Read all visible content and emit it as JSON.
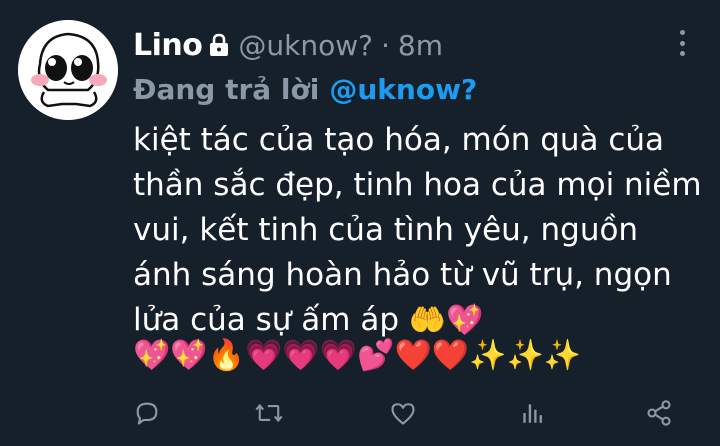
{
  "tweet": {
    "author_name": "Lino",
    "author_handle": "@uknow?",
    "separator": "·",
    "timestamp": "8m",
    "reply_label": "Đang trả lời",
    "reply_to": "@uknow?",
    "text": "kiệt tác của tạo hóa, món quà của thần sắc đẹp, tinh hoa của mọi niềm vui, kết tinh của tình yêu, nguồn ánh sáng hoàn hảo từ vũ trụ, ngọn lửa của sự ấm áp",
    "text_trailing_emoji": "🤲💖",
    "emoji_line": "💖💖🔥💗💗💗💕❤️❤️✨✨✨"
  },
  "icons": {
    "lock": "lock-icon",
    "more": "more-vertical-icon",
    "reply": "reply-icon",
    "retweet": "retweet-icon",
    "like": "heart-icon",
    "analytics": "analytics-icon",
    "share": "share-icon"
  },
  "colors": {
    "background": "#15202b",
    "secondary_text": "#8b98a5",
    "accent": "#1d9bf0",
    "primary_text": "#ffffff"
  }
}
